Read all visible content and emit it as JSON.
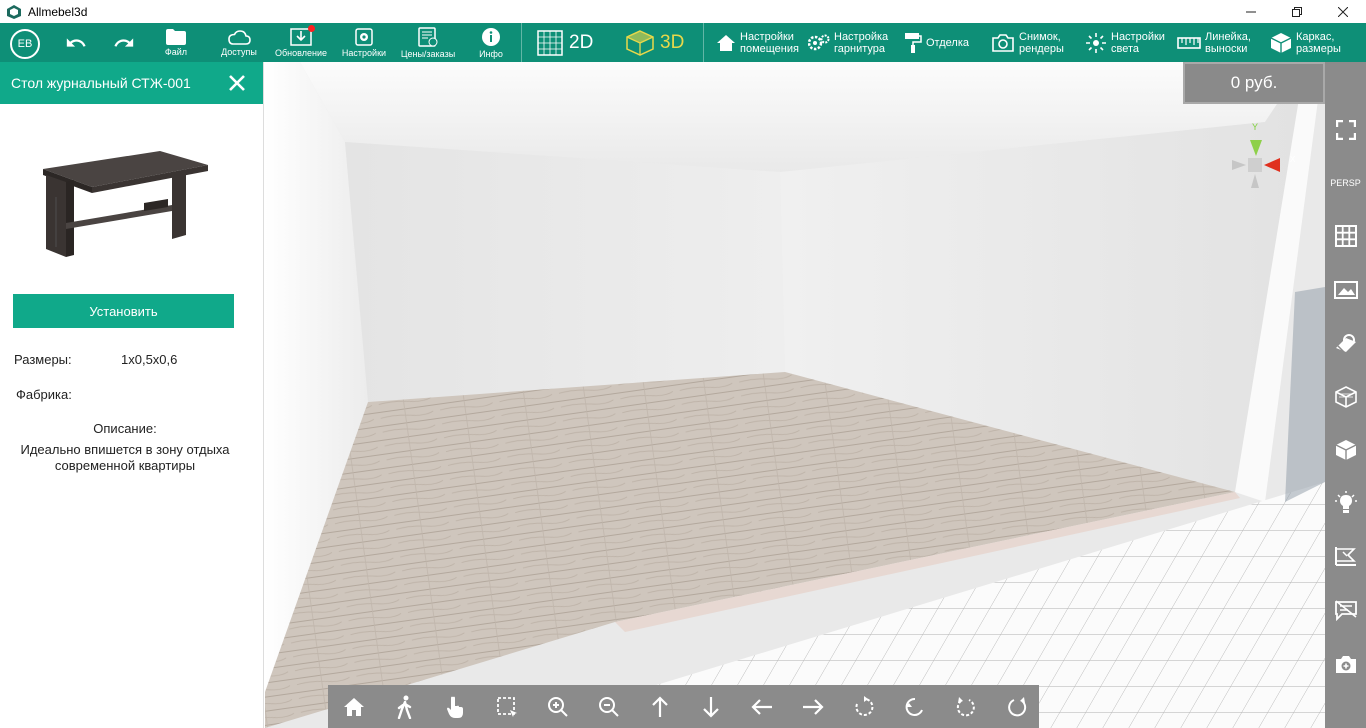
{
  "window": {
    "title": "Allmebel3d"
  },
  "user": {
    "initials": "EB"
  },
  "toolbar": {
    "file": "Файл",
    "access": "Доступы",
    "update": "Обновление",
    "settings": "Настройки",
    "prices": "Цены/заказы",
    "info": "Инфо",
    "view_2d": "2D",
    "view_3d": "3D",
    "room_settings_1": "Настройки",
    "room_settings_2": "помещения",
    "set_settings_1": "Настройка",
    "set_settings_2": "гарнитура",
    "finishing": "Отделка",
    "snapshot_1": "Снимок,",
    "snapshot_2": "рендеры",
    "light_1": "Настройки",
    "light_2": "света",
    "ruler_1": "Линейка,",
    "ruler_2": "выноски",
    "frame_1": "Каркас,",
    "frame_2": "размеры"
  },
  "panel": {
    "title": "Стол журнальный СТЖ-001",
    "install_label": "Установить",
    "size_label": "Размеры:",
    "size_value": "1x0,5x0,6",
    "factory_label": "Фабрика:",
    "description_title": "Описание:",
    "description_text": "Идеально впишется в зону отдыха современной квартиры"
  },
  "viewport": {
    "price": "0 руб.",
    "projection": "PERSP",
    "gizmo_y": "Y",
    "gizmo_x": "X"
  },
  "colors": {
    "toolbar": "#0e8f77",
    "accent": "#10a98a",
    "panel_gray": "#8b8b8b",
    "view3d_active": "#e8d84a"
  }
}
